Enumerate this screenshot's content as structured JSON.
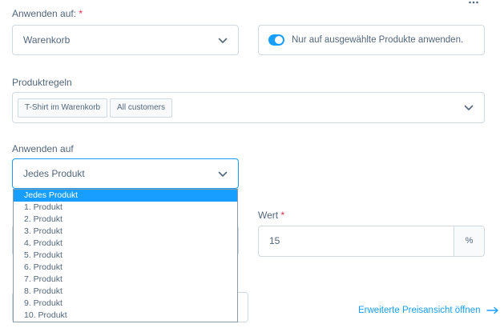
{
  "apply_on": {
    "label": "Anwenden auf:",
    "required_mark": "*",
    "value": "Warenkorb"
  },
  "only_selected_toggle": {
    "label": "Nur auf ausgewählte Produkte anwenden.",
    "checked": true
  },
  "product_rules": {
    "label": "Produktregeln",
    "tags": [
      "T-Shirt im Warenkorb",
      "All customers"
    ]
  },
  "apply_to": {
    "label": "Anwenden auf",
    "value": "Jedes Produkt",
    "options": [
      "Jedes Produkt",
      "1. Produkt",
      "2. Produkt",
      "3. Produkt",
      "4. Produkt",
      "5. Produkt",
      "6. Produkt",
      "7. Produkt",
      "8. Produkt",
      "9. Produkt",
      "10. Produkt"
    ],
    "selected_index": 0
  },
  "value_field": {
    "label": "Wert",
    "required_mark": "*",
    "value": "15",
    "unit": "%"
  },
  "advanced_link": {
    "label": "Erweiterte Preisansicht öffnen"
  },
  "colors": {
    "accent": "#189eff",
    "text": "#52667a",
    "border": "#d1d9e0",
    "required": "#de294c"
  },
  "icons": {
    "more": "more-horizontal-icon",
    "chevron": "chevron-down-icon",
    "arrow": "arrow-right-icon"
  }
}
